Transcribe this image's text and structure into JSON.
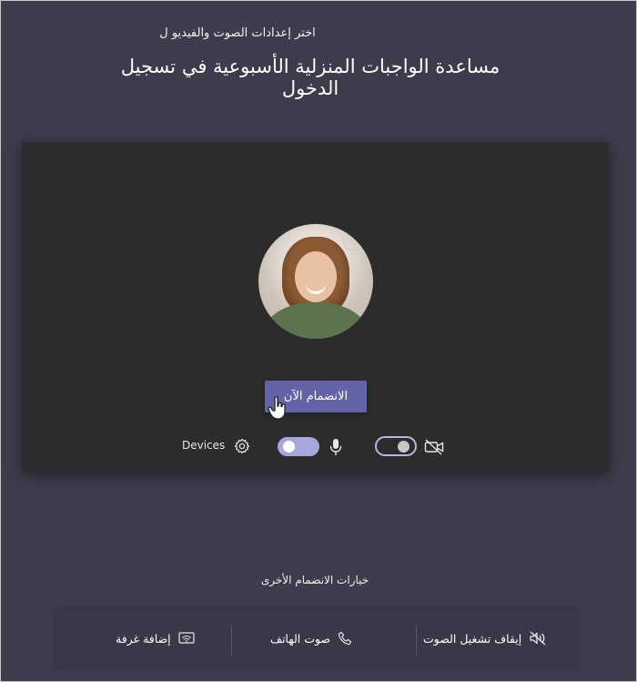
{
  "header": {
    "subtitle": "اختر إعدادات الصوت والفيديو ل",
    "title": "مساعدة الواجبات المنزلية الأسبوعية في تسجيل الدخول"
  },
  "preview": {
    "join_label": "الانضمام الآن",
    "devices_label": "Devices"
  },
  "other_options": {
    "title": "خيارات الانضمام الأخرى",
    "items": [
      {
        "label": "إيقاف تشغيل الصوت",
        "icon": "audio-off-icon"
      },
      {
        "label": "صوت الهاتف",
        "icon": "phone-icon"
      },
      {
        "label": "إضافة غرفة",
        "icon": "room-cast-icon"
      }
    ]
  },
  "colors": {
    "background": "#3d3c4c",
    "preview_bg": "#2d2c2c",
    "accent": "#6264a7",
    "toggle_on": "#a6a7dc"
  }
}
